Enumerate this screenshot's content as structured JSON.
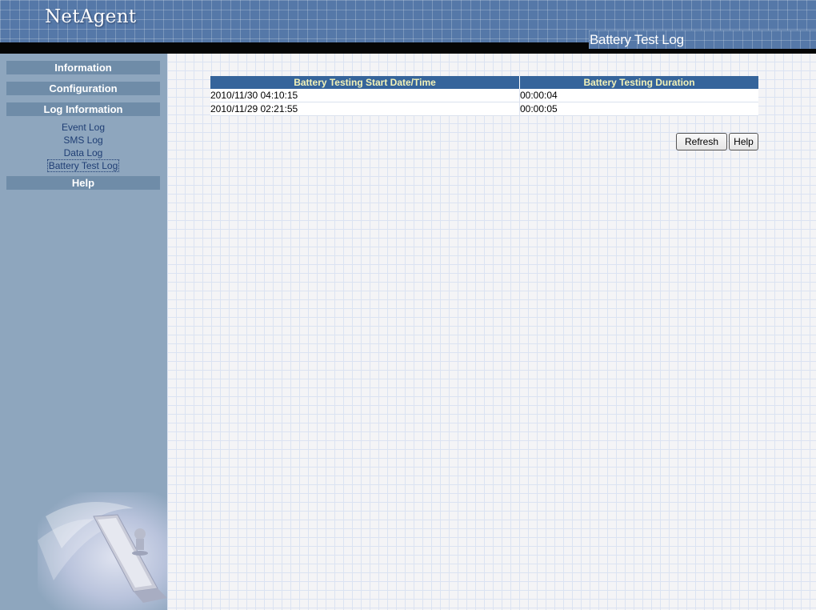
{
  "header": {
    "logo": "NetAgent",
    "page_title": "Battery Test Log"
  },
  "sidebar": {
    "sections": [
      {
        "label": "Information"
      },
      {
        "label": "Configuration"
      },
      {
        "label": "Log Information"
      }
    ],
    "log_links": [
      {
        "label": "Event Log"
      },
      {
        "label": "SMS Log"
      },
      {
        "label": "Data Log"
      },
      {
        "label": "Battery Test Log",
        "active": true
      }
    ],
    "help": "Help"
  },
  "table": {
    "columns": [
      "Battery Testing Start Date/Time",
      "Battery Testing Duration"
    ],
    "rows": [
      [
        "2010/11/30 04:10:15",
        "00:00:04"
      ],
      [
        "2010/11/29 02:21:55",
        "00:00:05"
      ]
    ]
  },
  "buttons": {
    "refresh": "Refresh",
    "help": "Help"
  },
  "colors": {
    "header_bg": "#5578a8",
    "sidebar_bg": "#8ea6be",
    "table_header_bg": "#35649b",
    "table_header_text": "#f2f2b8"
  }
}
